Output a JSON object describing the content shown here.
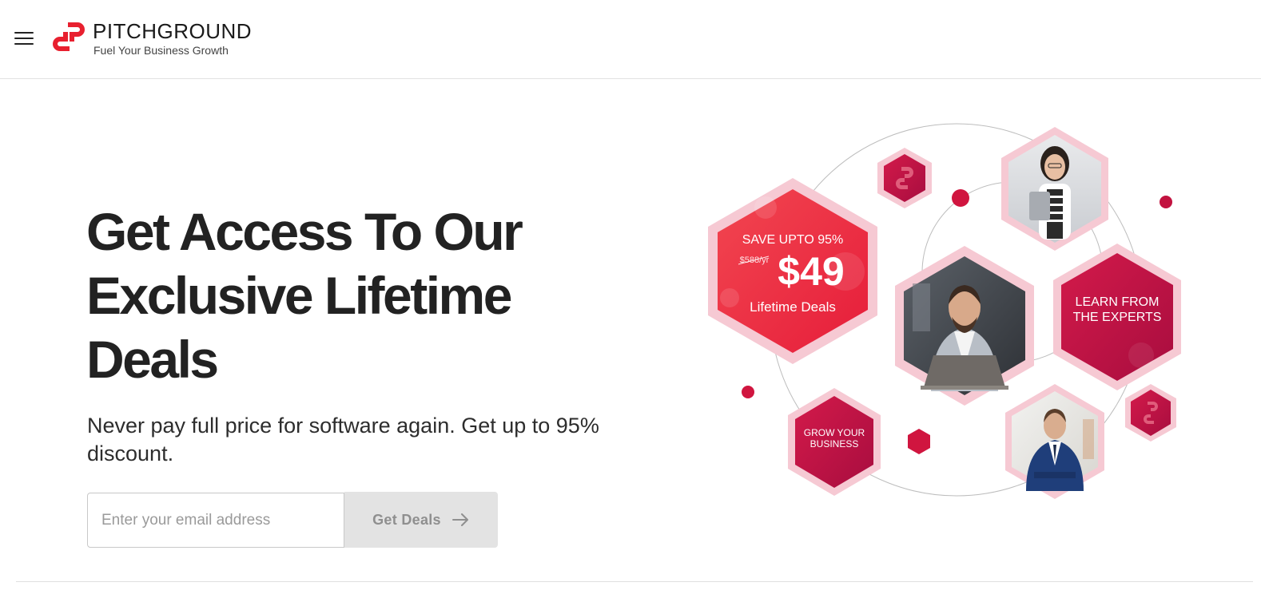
{
  "header": {
    "brand_name": "PITCHGROUND",
    "tagline": "Fuel Your Business Growth"
  },
  "hero": {
    "title_line1": "Get Access To Our",
    "title_line2": "Exclusive Lifetime",
    "title_line3": "Deals",
    "subtitle": "Never pay full price for software again. Get up to 95% discount.",
    "email_placeholder": "Enter your email address",
    "cta_label": "Get Deals"
  },
  "illustration": {
    "save_text": "SAVE UPTO 95%",
    "old_price": "$588/yr",
    "price": "$49",
    "deal_label": "Lifetime Deals",
    "learn_line1": "LEARN FROM",
    "learn_line2": "THE EXPERTS",
    "grow_line1": "GROW YOUR",
    "grow_line2": "BUSINESS"
  },
  "colors": {
    "brand_red": "#e8202f",
    "hex_crimson": "#c2123f",
    "hex_pink_ring": "#f6c9d3",
    "cta_bg": "#e3e3e3"
  }
}
